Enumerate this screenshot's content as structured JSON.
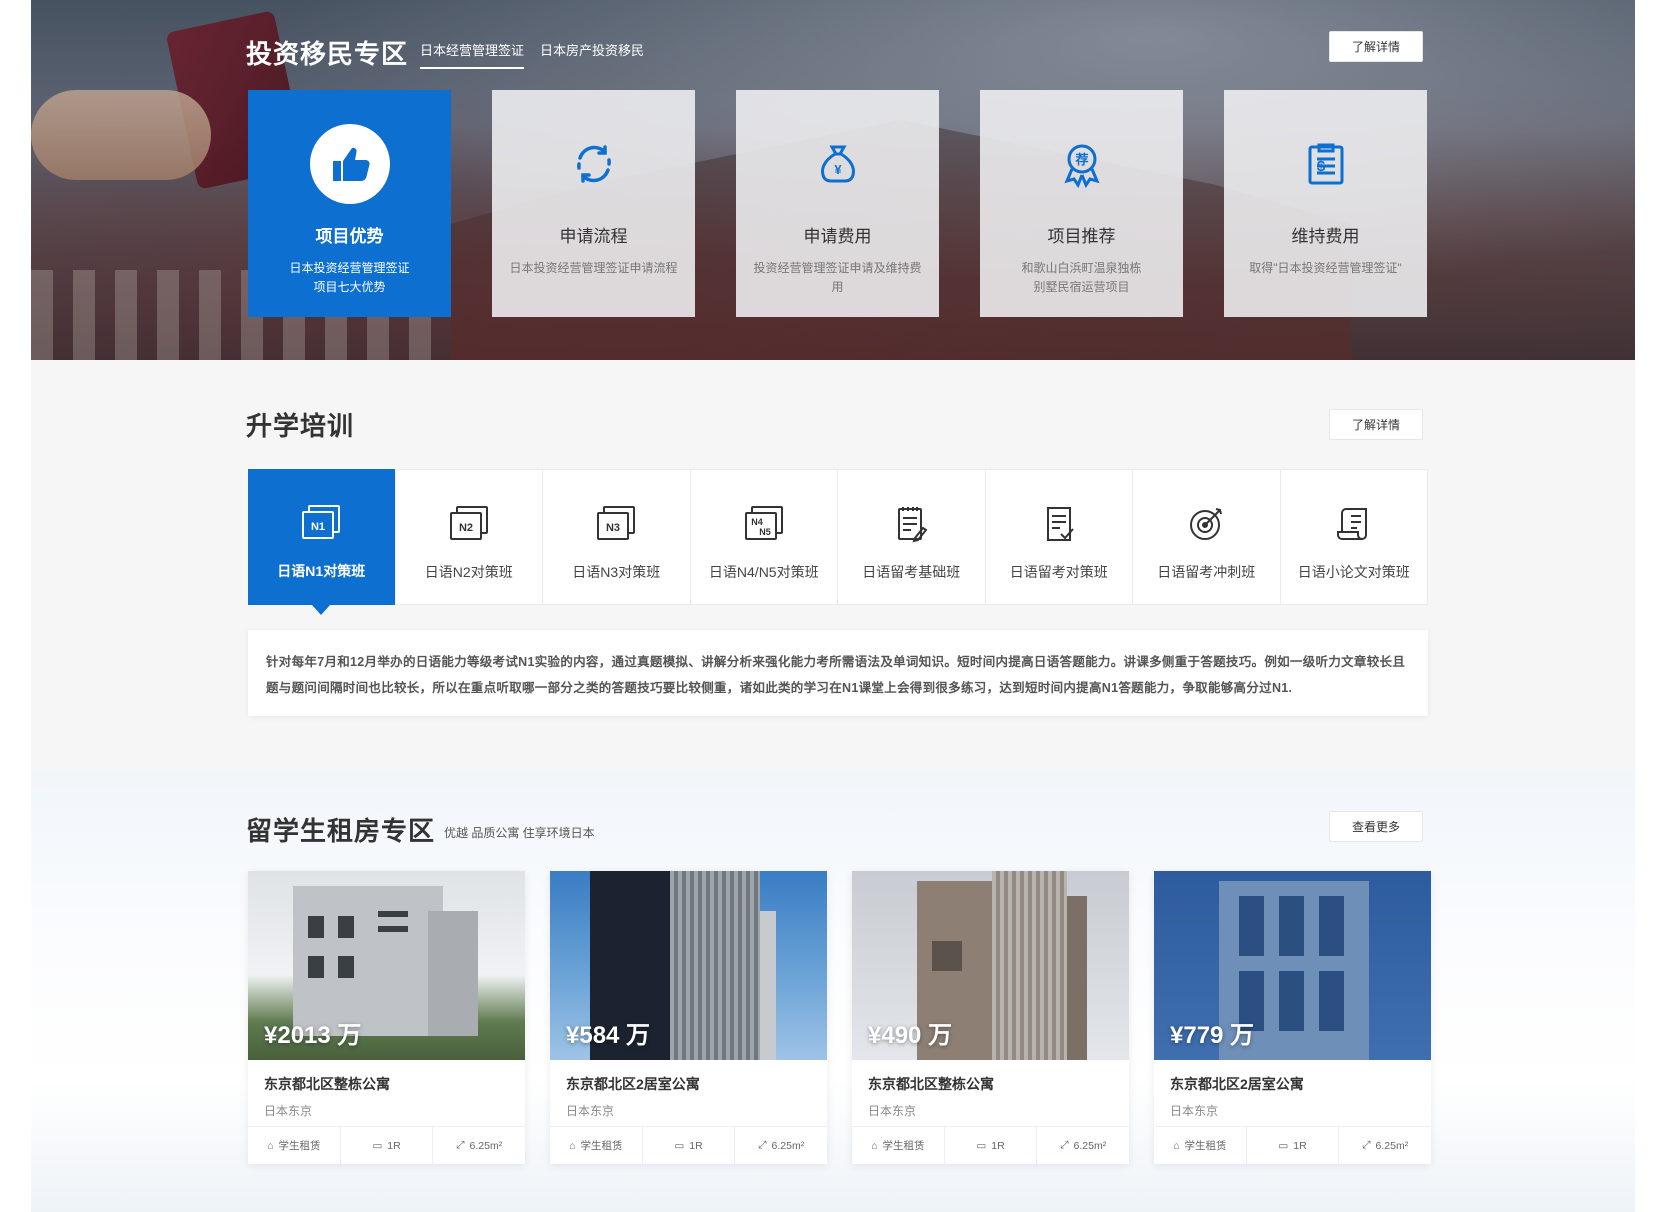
{
  "hero": {
    "title": "投资移民专区",
    "tabs": [
      "日本经营管理签证",
      "日本房产投资移民"
    ],
    "detail_label": "了解详情",
    "cards": [
      {
        "title": "项目优势",
        "sub1": "日本投资经营管理签证",
        "sub2": "项目七大优势",
        "icon": "thumbs-up-icon"
      },
      {
        "title": "申请流程",
        "sub1": "日本投资经营管理签证申请流程",
        "sub2": "",
        "icon": "refresh-cycle-icon"
      },
      {
        "title": "申请费用",
        "sub1": "投资经营管理签证申请及维持费用",
        "sub2": "",
        "icon": "money-bag-icon"
      },
      {
        "title": "项目推荐",
        "sub1": "和歌山白浜町温泉独栋",
        "sub2": "别墅民宿运营项目",
        "icon": "recommend-badge-icon"
      },
      {
        "title": "维持费用",
        "sub1": "取得\"日本投资经营管理签证\"",
        "sub2": "",
        "icon": "clipboard-dollar-icon"
      }
    ]
  },
  "training": {
    "title": "升学培训",
    "detail_label": "了解详情",
    "tabs": [
      {
        "label": "日语N1对策班",
        "icon": "n1-icon"
      },
      {
        "label": "日语N2对策班",
        "icon": "n2-icon"
      },
      {
        "label": "日语N3对策班",
        "icon": "n3-icon"
      },
      {
        "label": "日语N4/N5对策班",
        "icon": "n4-n5-icon"
      },
      {
        "label": "日语留考基础班",
        "icon": "notepad-pen-icon"
      },
      {
        "label": "日语留考对策班",
        "icon": "document-check-icon"
      },
      {
        "label": "日语留考冲刺班",
        "icon": "target-icon"
      },
      {
        "label": "日语小论文对策班",
        "icon": "scroll-icon"
      }
    ],
    "description": "针对每年7月和12月举办的日语能力等级考试N1实验的内容，通过真题模拟、讲解分析来强化能力考所需语法及单词知识。短时间内提高日语答题能力。讲课多侧重于答题技巧。例如一级听力文章较长且题与题问间隔时间也比较长，所以在重点听取哪一部分之类的答题技巧要比较侧重，诸如此类的学习在N1课堂上会得到很多练习，达到短时间内提高N1答题能力，争取能够高分过N1."
  },
  "rental": {
    "title": "留学生租房专区",
    "subtitle": "优越  品质公寓  住享环境日本",
    "more_label": "查看更多",
    "properties": [
      {
        "price": "¥2013 万",
        "name": "东京都北区整栋公寓",
        "location": "日本东京",
        "type": "学生租赁",
        "rooms": "1R",
        "area": "6.25m²"
      },
      {
        "price": "¥584 万",
        "name": "东京都北区2居室公寓",
        "location": "日本东京",
        "type": "学生租赁",
        "rooms": "1R",
        "area": "6.25m²"
      },
      {
        "price": "¥490 万",
        "name": "东京都北区整栋公寓",
        "location": "日本东京",
        "type": "学生租赁",
        "rooms": "1R",
        "area": "6.25m²"
      },
      {
        "price": "¥779 万",
        "name": "东京都北区2居室公寓",
        "location": "日本东京",
        "type": "学生租赁",
        "rooms": "1R",
        "area": "6.25m²"
      }
    ]
  },
  "colors": {
    "accent": "#0d6fd0"
  }
}
